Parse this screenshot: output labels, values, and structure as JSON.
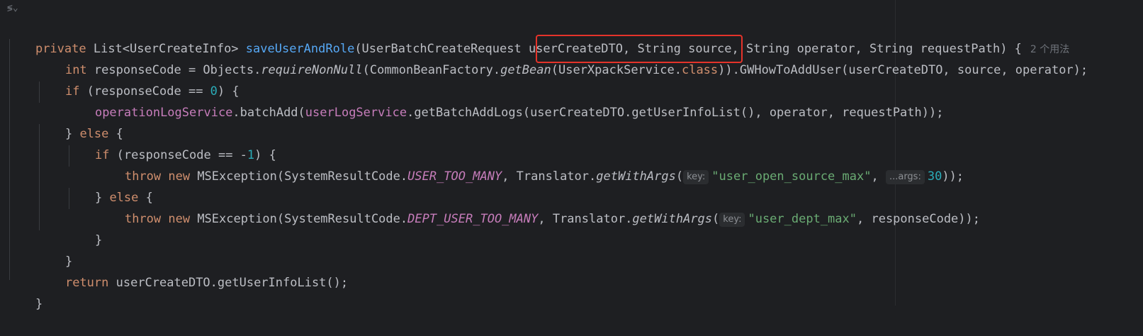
{
  "editor": {
    "fold_icon": "≶⌄",
    "usages_hint": "2 个用法",
    "highlight_color": "#e5332a",
    "lines": {
      "l1": {
        "kw": "private ",
        "t1": "List<UserCreateInfo> ",
        "fn": "saveUserAndRole",
        "t2": "(UserBatchCreateRequest userCreateDTO, String source, String operator, String requestPath) {"
      },
      "l2": {
        "kw": "int ",
        "t1": "responseCode = Objects.",
        "s1": "requireNonNull",
        "t2": "(CommonBeanFactory.",
        "s2": "getBean",
        "t3": "(UserXpackService.",
        "kw2": "class",
        "t4": ")).GWHowToAddUser(userCreateDTO, source, operator);"
      },
      "l3": {
        "kw": "if ",
        "t1": "(responseCode == ",
        "num": "0",
        "t2": ") {"
      },
      "l4": {
        "f1": "operationLogService",
        "t1": ".batchAdd(",
        "f2": "userLogService",
        "t2": ".getBatchAddLogs(userCreateDTO.getUserInfoList(), operator, requestPath));"
      },
      "l5": {
        "t1": "} ",
        "kw": "else ",
        "t2": "{"
      },
      "l6": {
        "kw": "if ",
        "t1": "(responseCode == -",
        "num": "1",
        "t2": ") {"
      },
      "l7": {
        "kw": "throw new ",
        "t1": "MSException(SystemResultCode.",
        "c1": "USER_TOO_MANY",
        "t2": ", Translator.",
        "s1": "getWithArgs",
        "t3": "(",
        "h1": "key:",
        "str": "\"user_open_source_max\"",
        "t4": ", ",
        "h2": "...args:",
        "num": "30",
        "t5": "));"
      },
      "l8": {
        "t1": "} ",
        "kw": "else ",
        "t2": "{"
      },
      "l9": {
        "kw": "throw new ",
        "t1": "MSException(SystemResultCode.",
        "c1": "DEPT_USER_TOO_MANY",
        "t2": ", Translator.",
        "s1": "getWithArgs",
        "t3": "(",
        "h1": "key:",
        "str": "\"user_dept_max\"",
        "t4": ", responseCode));"
      },
      "l10": {
        "t1": "}"
      },
      "l11": {
        "t1": "}"
      },
      "l12": {
        "kw": "return ",
        "t1": "userCreateDTO.getUserInfoList();"
      },
      "l13": {
        "t1": "}"
      }
    }
  }
}
